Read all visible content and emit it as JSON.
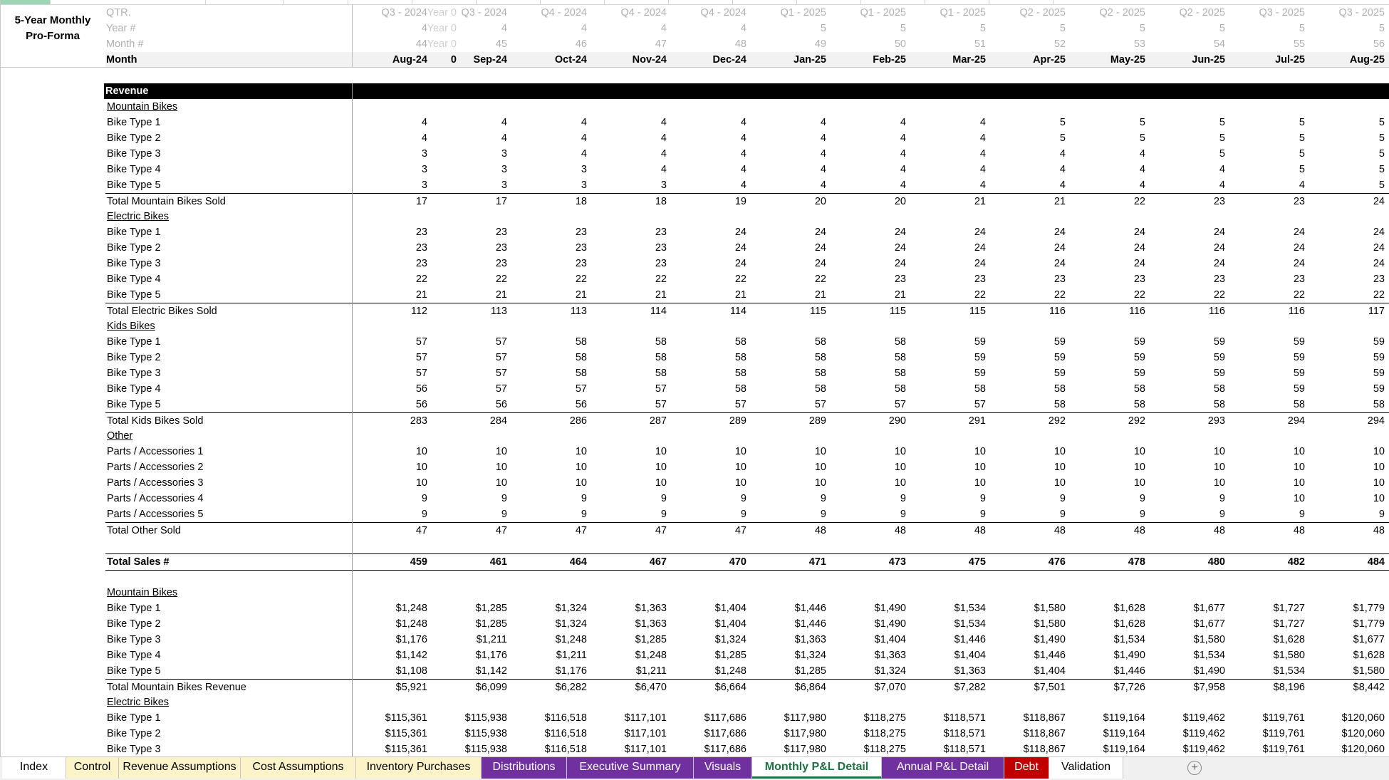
{
  "title": "5-Year Monthly Pro-Forma",
  "header": {
    "qtr": {
      "label": "QTR.",
      "start": "Year 0",
      "values": [
        "Q3 - 2024",
        "Q3 - 2024",
        "Q4 - 2024",
        "Q4 - 2024",
        "Q4 - 2024",
        "Q1 - 2025",
        "Q1 - 2025",
        "Q1 - 2025",
        "Q2 - 2025",
        "Q2 - 2025",
        "Q2 - 2025",
        "Q3 - 2025",
        "Q3 - 2025"
      ]
    },
    "year": {
      "label": "Year #",
      "start": "Year 0",
      "values": [
        "4",
        "4",
        "4",
        "4",
        "4",
        "5",
        "5",
        "5",
        "5",
        "5",
        "5",
        "5",
        "5"
      ]
    },
    "monthnum": {
      "label": "Month #",
      "start": "Year 0",
      "values": [
        "44",
        "45",
        "46",
        "47",
        "48",
        "49",
        "50",
        "51",
        "52",
        "53",
        "54",
        "55",
        "56"
      ]
    },
    "month": {
      "label": "Month",
      "start": "0",
      "values": [
        "Aug-24",
        "Sep-24",
        "Oct-24",
        "Nov-24",
        "Dec-24",
        "Jan-25",
        "Feb-25",
        "Mar-25",
        "Apr-25",
        "May-25",
        "Jun-25",
        "Jul-25",
        "Aug-25"
      ]
    }
  },
  "revenue_label": "Revenue",
  "rows": [
    {
      "label": "Mountain Bikes",
      "type": "section",
      "values": []
    },
    {
      "label": "Bike Type 1",
      "type": "item",
      "values": [
        "4",
        "4",
        "4",
        "4",
        "4",
        "4",
        "4",
        "4",
        "5",
        "5",
        "5",
        "5",
        "5"
      ]
    },
    {
      "label": "Bike Type 2",
      "type": "item",
      "values": [
        "4",
        "4",
        "4",
        "4",
        "4",
        "4",
        "4",
        "4",
        "5",
        "5",
        "5",
        "5",
        "5"
      ]
    },
    {
      "label": "Bike Type 3",
      "type": "item",
      "values": [
        "3",
        "3",
        "4",
        "4",
        "4",
        "4",
        "4",
        "4",
        "4",
        "4",
        "5",
        "5",
        "5"
      ]
    },
    {
      "label": "Bike Type 4",
      "type": "item",
      "values": [
        "3",
        "3",
        "3",
        "4",
        "4",
        "4",
        "4",
        "4",
        "4",
        "4",
        "4",
        "5",
        "5"
      ]
    },
    {
      "label": "Bike Type 5",
      "type": "item",
      "values": [
        "3",
        "3",
        "3",
        "3",
        "4",
        "4",
        "4",
        "4",
        "4",
        "4",
        "4",
        "4",
        "5"
      ]
    },
    {
      "label": "Total Mountain Bikes Sold",
      "type": "total",
      "values": [
        "17",
        "17",
        "18",
        "18",
        "19",
        "20",
        "20",
        "21",
        "21",
        "22",
        "23",
        "23",
        "24"
      ]
    },
    {
      "label": "Electric Bikes",
      "type": "section",
      "values": []
    },
    {
      "label": "Bike Type 1",
      "type": "item",
      "values": [
        "23",
        "23",
        "23",
        "23",
        "24",
        "24",
        "24",
        "24",
        "24",
        "24",
        "24",
        "24",
        "24"
      ]
    },
    {
      "label": "Bike Type 2",
      "type": "item",
      "values": [
        "23",
        "23",
        "23",
        "23",
        "24",
        "24",
        "24",
        "24",
        "24",
        "24",
        "24",
        "24",
        "24"
      ]
    },
    {
      "label": "Bike Type 3",
      "type": "item",
      "values": [
        "23",
        "23",
        "23",
        "23",
        "24",
        "24",
        "24",
        "24",
        "24",
        "24",
        "24",
        "24",
        "24"
      ]
    },
    {
      "label": "Bike Type 4",
      "type": "item",
      "values": [
        "22",
        "22",
        "22",
        "22",
        "22",
        "22",
        "23",
        "23",
        "23",
        "23",
        "23",
        "23",
        "23"
      ]
    },
    {
      "label": "Bike Type 5",
      "type": "item",
      "values": [
        "21",
        "21",
        "21",
        "21",
        "21",
        "21",
        "21",
        "22",
        "22",
        "22",
        "22",
        "22",
        "22"
      ]
    },
    {
      "label": "Total Electric Bikes Sold",
      "type": "total",
      "values": [
        "112",
        "113",
        "113",
        "114",
        "114",
        "115",
        "115",
        "115",
        "116",
        "116",
        "116",
        "116",
        "117"
      ]
    },
    {
      "label": "Kids Bikes",
      "type": "section",
      "values": []
    },
    {
      "label": "Bike Type 1",
      "type": "item",
      "values": [
        "57",
        "57",
        "58",
        "58",
        "58",
        "58",
        "58",
        "59",
        "59",
        "59",
        "59",
        "59",
        "59"
      ]
    },
    {
      "label": "Bike Type 2",
      "type": "item",
      "values": [
        "57",
        "57",
        "58",
        "58",
        "58",
        "58",
        "58",
        "59",
        "59",
        "59",
        "59",
        "59",
        "59"
      ]
    },
    {
      "label": "Bike Type 3",
      "type": "item",
      "values": [
        "57",
        "57",
        "58",
        "58",
        "58",
        "58",
        "58",
        "59",
        "59",
        "59",
        "59",
        "59",
        "59"
      ]
    },
    {
      "label": "Bike Type 4",
      "type": "item",
      "values": [
        "56",
        "57",
        "57",
        "57",
        "58",
        "58",
        "58",
        "58",
        "58",
        "58",
        "58",
        "59",
        "59"
      ]
    },
    {
      "label": "Bike Type 5",
      "type": "item",
      "values": [
        "56",
        "56",
        "56",
        "57",
        "57",
        "57",
        "57",
        "57",
        "58",
        "58",
        "58",
        "58",
        "58"
      ]
    },
    {
      "label": "Total Kids Bikes Sold",
      "type": "total",
      "values": [
        "283",
        "284",
        "286",
        "287",
        "289",
        "289",
        "290",
        "291",
        "292",
        "292",
        "293",
        "294",
        "294"
      ]
    },
    {
      "label": "Other",
      "type": "section",
      "values": []
    },
    {
      "label": "Parts / Accessories 1",
      "type": "item",
      "values": [
        "10",
        "10",
        "10",
        "10",
        "10",
        "10",
        "10",
        "10",
        "10",
        "10",
        "10",
        "10",
        "10"
      ]
    },
    {
      "label": "Parts / Accessories 2",
      "type": "item",
      "values": [
        "10",
        "10",
        "10",
        "10",
        "10",
        "10",
        "10",
        "10",
        "10",
        "10",
        "10",
        "10",
        "10"
      ]
    },
    {
      "label": "Parts / Accessories 3",
      "type": "item",
      "values": [
        "10",
        "10",
        "10",
        "10",
        "10",
        "10",
        "10",
        "10",
        "10",
        "10",
        "10",
        "10",
        "10"
      ]
    },
    {
      "label": "Parts / Accessories 4",
      "type": "item",
      "values": [
        "9",
        "9",
        "9",
        "9",
        "9",
        "9",
        "9",
        "9",
        "9",
        "9",
        "9",
        "10",
        "10"
      ]
    },
    {
      "label": "Parts / Accessories 5",
      "type": "item",
      "values": [
        "9",
        "9",
        "9",
        "9",
        "9",
        "9",
        "9",
        "9",
        "9",
        "9",
        "9",
        "9",
        "9"
      ]
    },
    {
      "label": "Total Other Sold",
      "type": "total",
      "values": [
        "47",
        "47",
        "47",
        "47",
        "47",
        "48",
        "48",
        "48",
        "48",
        "48",
        "48",
        "48",
        "48"
      ]
    },
    {
      "label": "",
      "type": "blank",
      "values": []
    },
    {
      "label": "Total Sales #",
      "type": "grand",
      "values": [
        "459",
        "461",
        "464",
        "467",
        "470",
        "471",
        "473",
        "475",
        "476",
        "478",
        "480",
        "482",
        "484"
      ]
    },
    {
      "label": "",
      "type": "blank",
      "values": []
    },
    {
      "label": "Mountain Bikes",
      "type": "section",
      "values": []
    },
    {
      "label": "Bike Type 1",
      "type": "item",
      "values": [
        "$1,248",
        "$1,285",
        "$1,324",
        "$1,363",
        "$1,404",
        "$1,446",
        "$1,490",
        "$1,534",
        "$1,580",
        "$1,628",
        "$1,677",
        "$1,727",
        "$1,779"
      ]
    },
    {
      "label": "Bike Type 2",
      "type": "item",
      "values": [
        "$1,248",
        "$1,285",
        "$1,324",
        "$1,363",
        "$1,404",
        "$1,446",
        "$1,490",
        "$1,534",
        "$1,580",
        "$1,628",
        "$1,677",
        "$1,727",
        "$1,779"
      ]
    },
    {
      "label": "Bike Type 3",
      "type": "item",
      "values": [
        "$1,176",
        "$1,211",
        "$1,248",
        "$1,285",
        "$1,324",
        "$1,363",
        "$1,404",
        "$1,446",
        "$1,490",
        "$1,534",
        "$1,580",
        "$1,628",
        "$1,677"
      ]
    },
    {
      "label": "Bike Type 4",
      "type": "item",
      "values": [
        "$1,142",
        "$1,176",
        "$1,211",
        "$1,248",
        "$1,285",
        "$1,324",
        "$1,363",
        "$1,404",
        "$1,446",
        "$1,490",
        "$1,534",
        "$1,580",
        "$1,628"
      ]
    },
    {
      "label": "Bike Type 5",
      "type": "item",
      "values": [
        "$1,108",
        "$1,142",
        "$1,176",
        "$1,211",
        "$1,248",
        "$1,285",
        "$1,324",
        "$1,363",
        "$1,404",
        "$1,446",
        "$1,490",
        "$1,534",
        "$1,580"
      ]
    },
    {
      "label": "Total Mountain Bikes Revenue",
      "type": "total",
      "values": [
        "$5,921",
        "$6,099",
        "$6,282",
        "$6,470",
        "$6,664",
        "$6,864",
        "$7,070",
        "$7,282",
        "$7,501",
        "$7,726",
        "$7,958",
        "$8,196",
        "$8,442"
      ]
    },
    {
      "label": "Electric Bikes",
      "type": "section",
      "values": []
    },
    {
      "label": "Bike Type 1",
      "type": "item",
      "values": [
        "$115,361",
        "$115,938",
        "$116,518",
        "$117,101",
        "$117,686",
        "$117,980",
        "$118,275",
        "$118,571",
        "$118,867",
        "$119,164",
        "$119,462",
        "$119,761",
        "$120,060"
      ]
    },
    {
      "label": "Bike Type 2",
      "type": "item",
      "values": [
        "$115,361",
        "$115,938",
        "$116,518",
        "$117,101",
        "$117,686",
        "$117,980",
        "$118,275",
        "$118,571",
        "$118,867",
        "$119,164",
        "$119,462",
        "$119,761",
        "$120,060"
      ]
    },
    {
      "label": "Bike Type 3",
      "type": "item",
      "values": [
        "$115,361",
        "$115,938",
        "$116,518",
        "$117,101",
        "$117,686",
        "$117,980",
        "$118,275",
        "$118,571",
        "$118,867",
        "$119,164",
        "$119,462",
        "$119,761",
        "$120,060"
      ]
    }
  ],
  "tabs": [
    {
      "label": "Index",
      "bg": "#ffffff",
      "color": "#000000",
      "active": false
    },
    {
      "label": "Control",
      "bg": "#fdf3c8",
      "color": "#000000",
      "active": false
    },
    {
      "label": "Revenue Assumptions",
      "bg": "#fdf3c8",
      "color": "#000000",
      "active": false
    },
    {
      "label": "Cost Assumptions",
      "bg": "#fdf3c8",
      "color": "#000000",
      "active": false
    },
    {
      "label": "Inventory Purchases",
      "bg": "#fdf3c8",
      "color": "#000000",
      "active": false
    },
    {
      "label": "Distributions",
      "bg": "#7030a0",
      "color": "#ffffff",
      "active": false
    },
    {
      "label": "Executive Summary",
      "bg": "#7030a0",
      "color": "#ffffff",
      "active": false
    },
    {
      "label": "Visuals",
      "bg": "#7030a0",
      "color": "#ffffff",
      "active": false
    },
    {
      "label": "Monthly P&L Detail",
      "bg": "#ffffff",
      "color": "#1f7244",
      "active": true
    },
    {
      "label": "Annual P&L Detail",
      "bg": "#7030a0",
      "color": "#ffffff",
      "active": false
    },
    {
      "label": "Debt",
      "bg": "#c00000",
      "color": "#ffffff",
      "active": false
    },
    {
      "label": "Validation",
      "bg": "#ffffff",
      "color": "#000000",
      "active": false
    }
  ],
  "add_sheet_label": "+"
}
